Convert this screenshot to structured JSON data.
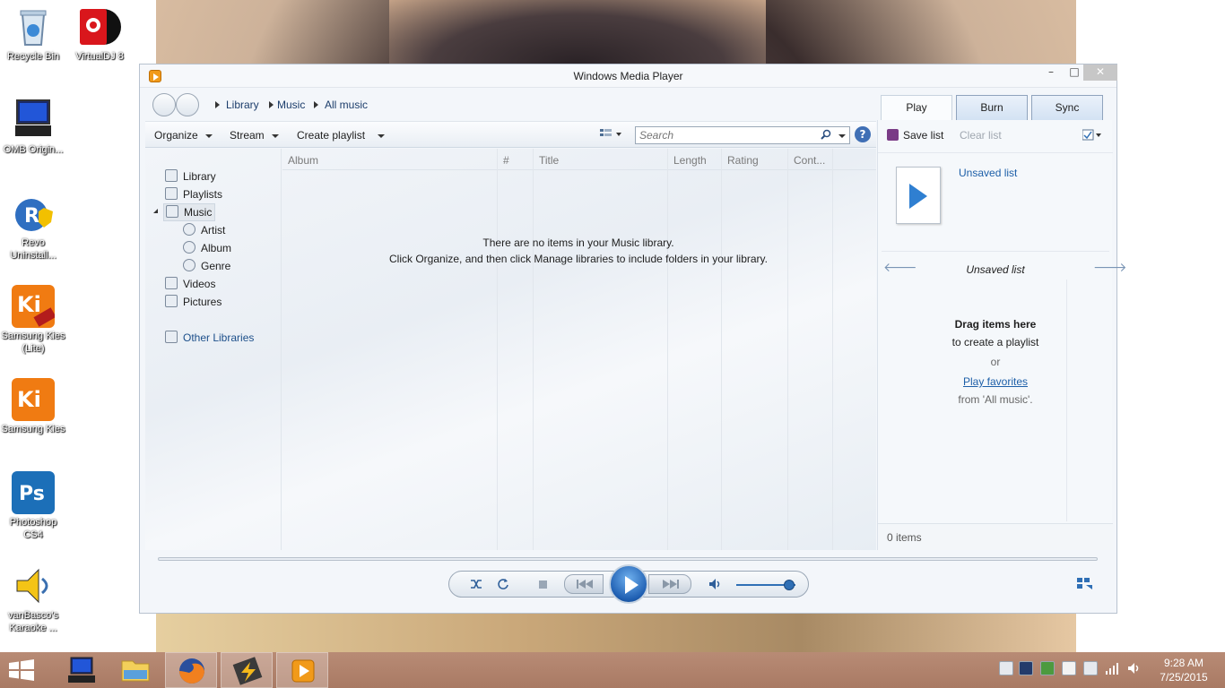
{
  "desktop": {
    "icons": [
      {
        "label": "Recycle Bin"
      },
      {
        "label": "VirtualDJ 8"
      },
      {
        "label": "OMB Origin..."
      },
      {
        "label": "Revo Uninstall..."
      },
      {
        "label": "Samsung Kies (Lite)"
      },
      {
        "label": "Samsung Kies"
      },
      {
        "label": "Photoshop CS4"
      },
      {
        "label": "vanBasco's Karaoke ..."
      }
    ]
  },
  "window": {
    "title": "Windows Media Player",
    "minimize": "–",
    "maximize": "□",
    "close": "✕"
  },
  "breadcrumb": [
    "Library",
    "Music",
    "All music"
  ],
  "toolbar": {
    "organize": "Organize",
    "stream": "Stream",
    "create_playlist": "Create playlist",
    "search_placeholder": "Search",
    "help": "?"
  },
  "nav": {
    "items": [
      {
        "label": "Library"
      },
      {
        "label": "Playlists"
      },
      {
        "label": "Music"
      },
      {
        "label": "Artist"
      },
      {
        "label": "Album"
      },
      {
        "label": "Genre"
      },
      {
        "label": "Videos"
      },
      {
        "label": "Pictures"
      },
      {
        "label": "Other Libraries"
      }
    ]
  },
  "columns": [
    "Album",
    "#",
    "Title",
    "Length",
    "Rating",
    "Cont..."
  ],
  "empty_message": {
    "line1": "There are no items in your Music library.",
    "line2": "Click Organize, and then click Manage libraries to include folders in your library."
  },
  "tabs": [
    "Play",
    "Burn",
    "Sync"
  ],
  "list_pane": {
    "save_list": "Save list",
    "clear_list": "Clear list",
    "unsaved_link": "Unsaved list",
    "list_title": "Unsaved list",
    "drag_title": "Drag items here",
    "drag_sub": "to create a playlist",
    "or": "or",
    "play_favorites": "Play favorites",
    "from_all": "from 'All music'.",
    "items_count": "0 items"
  },
  "colors": {
    "accent": "#2f6fb5",
    "link": "#1d5fa8",
    "taskbar": "#b08570"
  },
  "player": {
    "volume_fraction": 0.9
  },
  "taskbar": {
    "time": "9:28 AM",
    "date": "7/25/2015",
    "apps": [
      "windows-logo-icon",
      "computer-icon",
      "file-explorer-icon",
      "firefox-icon",
      "winamp-icon",
      "media-player-icon"
    ]
  }
}
